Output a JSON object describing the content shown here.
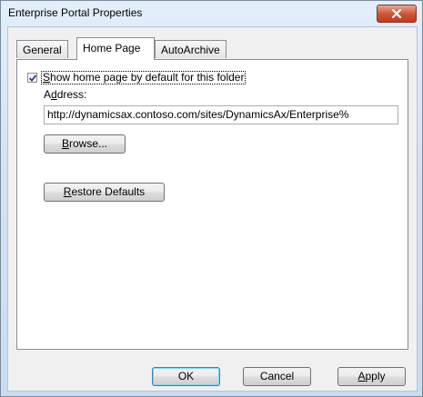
{
  "window": {
    "title": "Enterprise Portal Properties"
  },
  "tabs": [
    {
      "label": "General",
      "active": false
    },
    {
      "label": "Home Page",
      "active": true
    },
    {
      "label": "AutoArchive",
      "active": false
    }
  ],
  "home_page": {
    "show_default_label_key": "S",
    "show_default_label_rest": "how home page by default for this folder",
    "show_default_checked": true,
    "address_label_pre": "A",
    "address_label_key": "d",
    "address_label_post": "dress:",
    "address_value": "http://dynamicsax.contoso.com/sites/DynamicsAx/Enterprise%",
    "browse_key": "B",
    "browse_rest": "rowse...",
    "restore_key": "R",
    "restore_rest": "estore Defaults"
  },
  "footer": {
    "ok_label": "OK",
    "cancel_label": "Cancel",
    "apply_key": "A",
    "apply_rest": "pply"
  },
  "colors": {
    "close_button": "#c23b1f",
    "titlebar": "#d4e3f3",
    "panel": "#ffffff"
  }
}
